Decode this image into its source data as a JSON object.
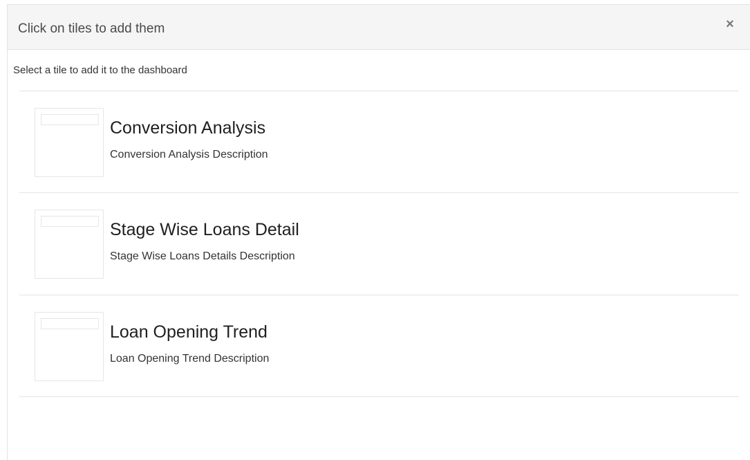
{
  "dialog": {
    "title": "Click on tiles to add them",
    "close_symbol": "×",
    "instructions": "Select a tile to add it to the dashboard"
  },
  "tiles": [
    {
      "title": "Conversion Analysis",
      "description": "Conversion Analysis Description"
    },
    {
      "title": "Stage Wise Loans Detail",
      "description": "Stage Wise Loans Details Description"
    },
    {
      "title": "Loan Opening Trend",
      "description": "Loan Opening Trend Description"
    }
  ],
  "icons": {
    "close": "close-icon"
  }
}
